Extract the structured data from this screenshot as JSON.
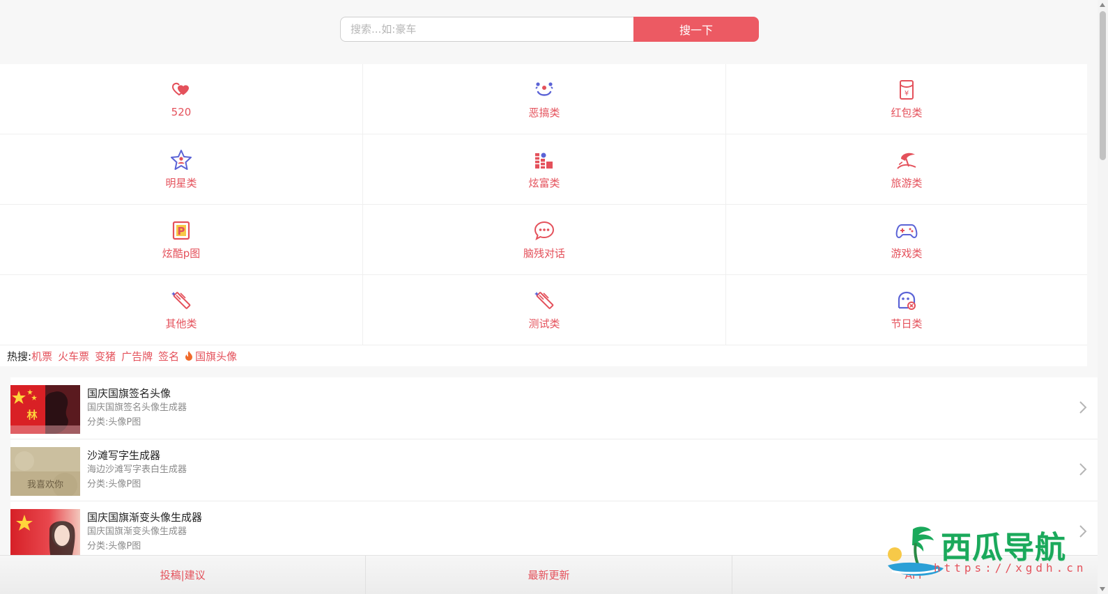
{
  "search": {
    "placeholder": "搜索...如:豪车",
    "button_label": "搜一下"
  },
  "categories": [
    {
      "label": "520",
      "icon": "heart-icon"
    },
    {
      "label": "恶搞类",
      "icon": "clown-face-icon"
    },
    {
      "label": "红包类",
      "icon": "red-envelope-icon"
    },
    {
      "label": "明星类",
      "icon": "star-person-icon"
    },
    {
      "label": "炫富类",
      "icon": "money-stack-icon"
    },
    {
      "label": "旅游类",
      "icon": "beach-umbrella-icon"
    },
    {
      "label": "炫酷p图",
      "icon": "parking-p-icon"
    },
    {
      "label": "脑残对话",
      "icon": "chat-bubble-icon"
    },
    {
      "label": "游戏类",
      "icon": "gamepad-icon"
    },
    {
      "label": "其他类",
      "icon": "magic-wand-icon"
    },
    {
      "label": "测试类",
      "icon": "magic-wand-icon"
    },
    {
      "label": "节日类",
      "icon": "festival-mask-icon"
    }
  ],
  "hot": {
    "title": "热搜:",
    "links": [
      "机票",
      "火车票",
      "变猪",
      "广告牌",
      "签名",
      "国旗头像"
    ]
  },
  "list": [
    {
      "title": "国庆国旗签名头像",
      "subtitle": "国庆国旗签名头像生成器",
      "category": "分类:头像P图",
      "thumb_glyph": "林"
    },
    {
      "title": "沙滩写字生成器",
      "subtitle": "海边沙滩写字表白生成器",
      "category": "分类:头像P图",
      "thumb_glyph": "我喜欢你"
    },
    {
      "title": "国庆国旗渐变头像生成器",
      "subtitle": "国庆国旗渐变头像生成器",
      "category": "分类:头像P图"
    }
  ],
  "bottom_tabs": [
    "投稿|建议",
    "最新更新",
    "APP"
  ],
  "watermark": {
    "title": "西瓜导航",
    "url": "https://xgdh.cn"
  },
  "colors": {
    "accent": "#e4515b",
    "button": "#ec5a63",
    "icon_blue": "#5b63d6"
  }
}
